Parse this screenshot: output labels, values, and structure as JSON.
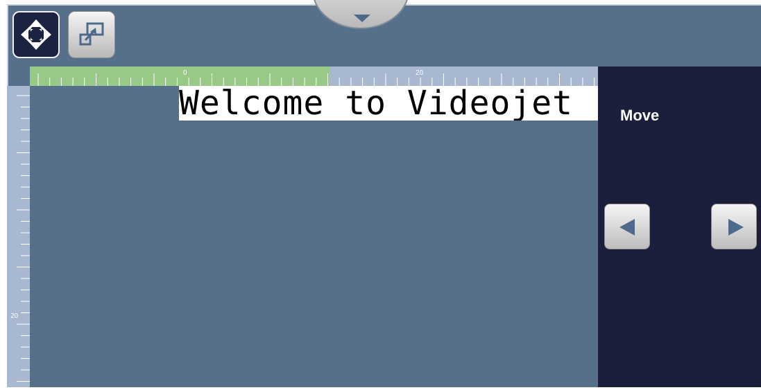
{
  "toolbar": {
    "move_tool_icon": "move-arrows-icon",
    "resize_tool_icon": "resize-icon",
    "pull_down_icon": "chevron-down-icon"
  },
  "ruler": {
    "h_label_0": "0",
    "h_label_20": "20",
    "v_label_20": "20"
  },
  "canvas": {
    "print_text": "Welcome to Videojet"
  },
  "panel": {
    "title": "Move",
    "left_button_icon": "arrow-left-icon",
    "right_button_icon": "arrow-right-icon"
  },
  "colors": {
    "workspace": "#566f8b",
    "panel": "#1b1f3b",
    "ruler": "#a7b8d0",
    "ruler_highlight": "#98c987"
  }
}
